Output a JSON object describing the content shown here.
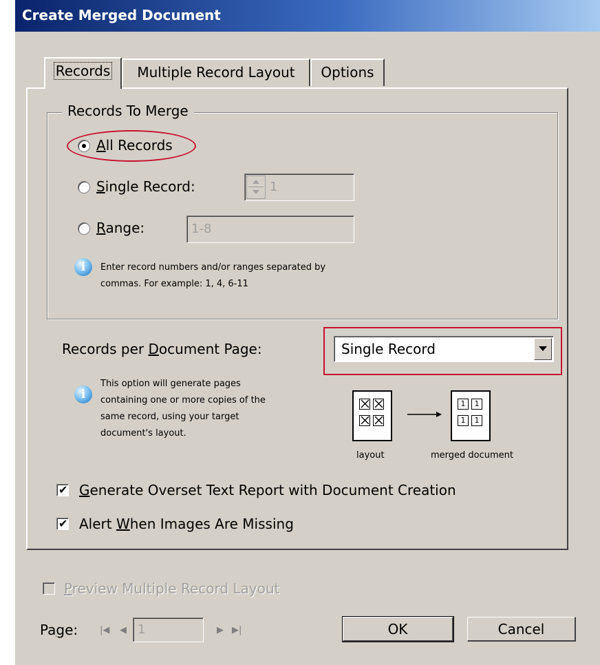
{
  "window": {
    "title": "Create Merged Document"
  },
  "tabs": [
    {
      "label": "Records",
      "active": true
    },
    {
      "label": "Multiple Record Layout",
      "active": false
    },
    {
      "label": "Options",
      "active": false
    }
  ],
  "records_to_merge": {
    "group_label": "Records To Merge",
    "all_records": {
      "label": "All Records",
      "selected": true
    },
    "single_record": {
      "label": "Single Record:",
      "value": "1",
      "selected": false
    },
    "range": {
      "label": "Range:",
      "value": "1-8",
      "selected": false
    },
    "info_line1": "Enter record numbers and/or ranges separated by",
    "info_line2": "commas. For example: 1, 4, 6-11"
  },
  "records_per_page": {
    "label": "Records per Document Page:",
    "selected": "Single Record",
    "info_lines": [
      "This option will generate pages",
      "containing one or more copies of the",
      "same record, using your target",
      "document's layout."
    ],
    "diagram": {
      "layout_caption": "layout",
      "merged_caption": "merged document",
      "cell_glyph": "1"
    }
  },
  "options": {
    "overset_report": {
      "label": "Generate Overset Text Report with Document Creation",
      "checked": true
    },
    "alert_images": {
      "label": "Alert When Images Are Missing",
      "checked": true
    }
  },
  "preview": {
    "label": "Preview Multiple Record Layout",
    "checked": false,
    "enabled": false
  },
  "page_nav": {
    "label": "Page:",
    "value": "1"
  },
  "buttons": {
    "ok": "OK",
    "cancel": "Cancel"
  },
  "colors": {
    "highlight": "#c8102e",
    "dialog_bg": "#d4d0c8",
    "title_start": "#0a246a",
    "title_end": "#a6caf0"
  },
  "icons": [
    "info-icon",
    "first-page-icon",
    "previous-page-icon",
    "next-page-icon",
    "last-page-icon",
    "dropdown-arrow-icon"
  ]
}
